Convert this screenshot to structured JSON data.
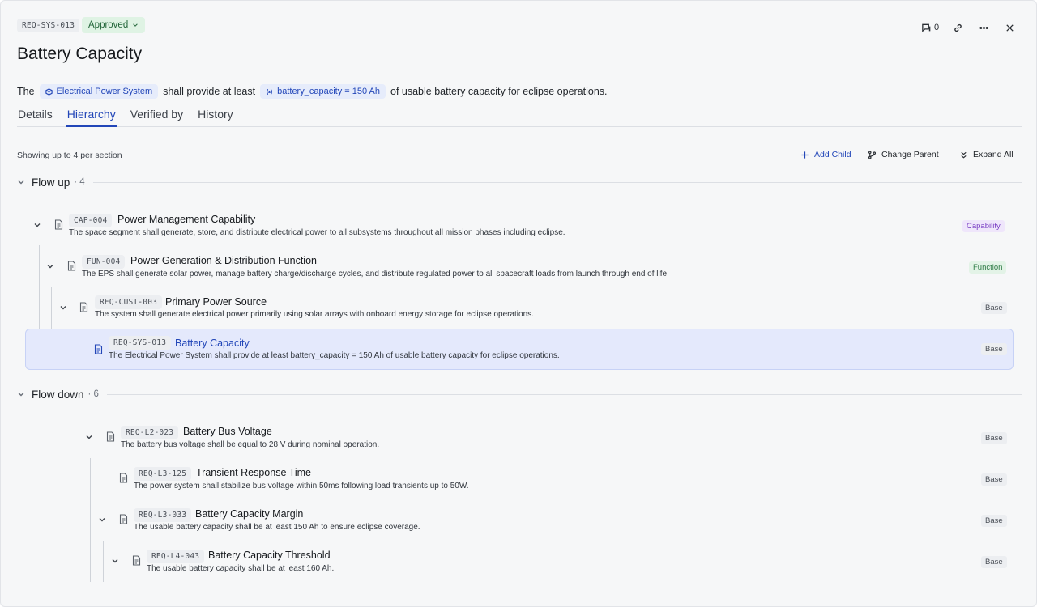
{
  "header": {
    "id": "REQ-SYS-013",
    "status": "Approved",
    "title": "Battery Capacity",
    "comment_count": "0"
  },
  "statement": {
    "prefix": "The",
    "system_chip": "Electrical Power System",
    "middle": "shall provide at least",
    "param_chip": "battery_capacity = 150 Ah",
    "suffix": "of usable battery capacity for eclipse operations."
  },
  "tabs": [
    "Details",
    "Hierarchy",
    "Verified by",
    "History"
  ],
  "active_tab": "Hierarchy",
  "toolbar": {
    "showing": "Showing up to 4 per section",
    "add_child": "Add Child",
    "change_parent": "Change Parent",
    "expand_all": "Expand All"
  },
  "flow_up": {
    "label": "Flow up",
    "count": "· 4",
    "items": [
      {
        "id": "CAP-004",
        "name": "Power Management Capability",
        "desc": "The space segment shall generate, store, and distribute electrical power to all subsystems throughout all mission phases including eclipse.",
        "badge": "Capability"
      },
      {
        "id": "FUN-004",
        "name": "Power Generation & Distribution Function",
        "desc": "The EPS shall generate solar power, manage battery charge/discharge cycles, and distribute regulated power to all spacecraft loads from launch through end of life.",
        "badge": "Function"
      },
      {
        "id": "REQ-CUST-003",
        "name": "Primary Power Source",
        "desc": "The system shall generate electrical power primarily using solar arrays with onboard energy storage for eclipse operations.",
        "badge": "Base"
      },
      {
        "id": "REQ-SYS-013",
        "name": "Battery Capacity",
        "desc": "The Electrical Power System shall provide at least battery_capacity = 150 Ah of usable battery capacity for eclipse operations.",
        "badge": "Base"
      }
    ]
  },
  "flow_down": {
    "label": "Flow down",
    "count": "· 6",
    "items": [
      {
        "id": "REQ-L2-023",
        "name": "Battery Bus Voltage",
        "desc": "The battery bus voltage shall be equal to 28 V during nominal operation.",
        "badge": "Base"
      },
      {
        "id": "REQ-L3-125",
        "name": "Transient Response Time",
        "desc": "The power system shall stabilize bus voltage within 50ms following load transients up to 50W.",
        "badge": "Base"
      },
      {
        "id": "REQ-L3-033",
        "name": "Battery Capacity Margin",
        "desc": "The usable battery capacity shall be at least 150 Ah to ensure eclipse coverage.",
        "badge": "Base"
      },
      {
        "id": "REQ-L4-043",
        "name": "Battery Capacity Threshold",
        "desc": "The usable battery capacity shall be at least 160 Ah.",
        "badge": "Base"
      }
    ]
  },
  "colors": {
    "accent": "#2246b8",
    "status_green": "#23663a",
    "capability": "#7a3fc4",
    "function": "#2c7a44"
  },
  "icons": [
    "comment-icon",
    "link-icon",
    "more-icon",
    "close-icon",
    "chevron-down-icon",
    "document-icon",
    "plus-icon",
    "branch-icon",
    "expand-icon",
    "system-icon",
    "parameter-icon"
  ]
}
